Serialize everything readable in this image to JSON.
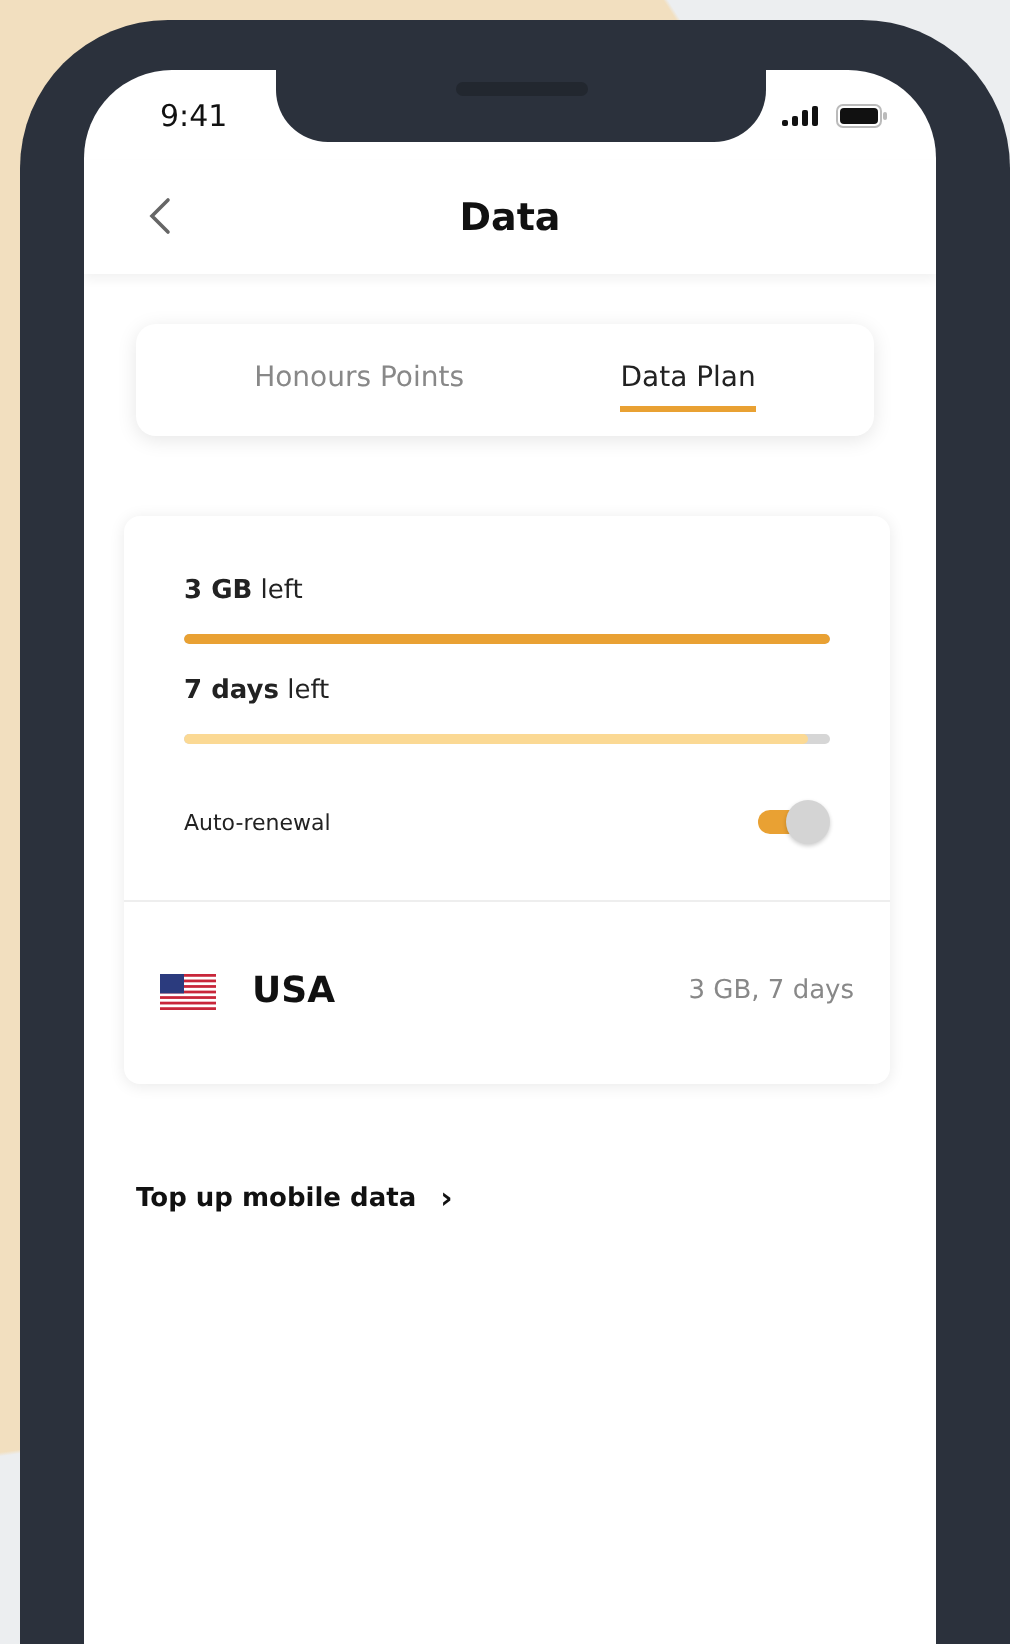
{
  "status_bar": {
    "time": "9:41"
  },
  "header": {
    "title": "Data"
  },
  "tabs": [
    {
      "label": "Honours Points",
      "selected": false
    },
    {
      "label": "Data Plan",
      "selected": true
    }
  ],
  "plan": {
    "meters": [
      {
        "kind": "data",
        "label": "**3 GB** left",
        "level": 1
      },
      {
        "kind": "time",
        "label": "**7 days** left",
        "level": 0.965
      }
    ],
    "auto_renewal": {
      "label": "Auto-renewal",
      "on": true
    },
    "country": {
      "name": "USA",
      "summary": "3 GB, 7 days"
    }
  },
  "top_up_link": {
    "label": "Top up mobile data",
    "arrow": "›"
  }
}
